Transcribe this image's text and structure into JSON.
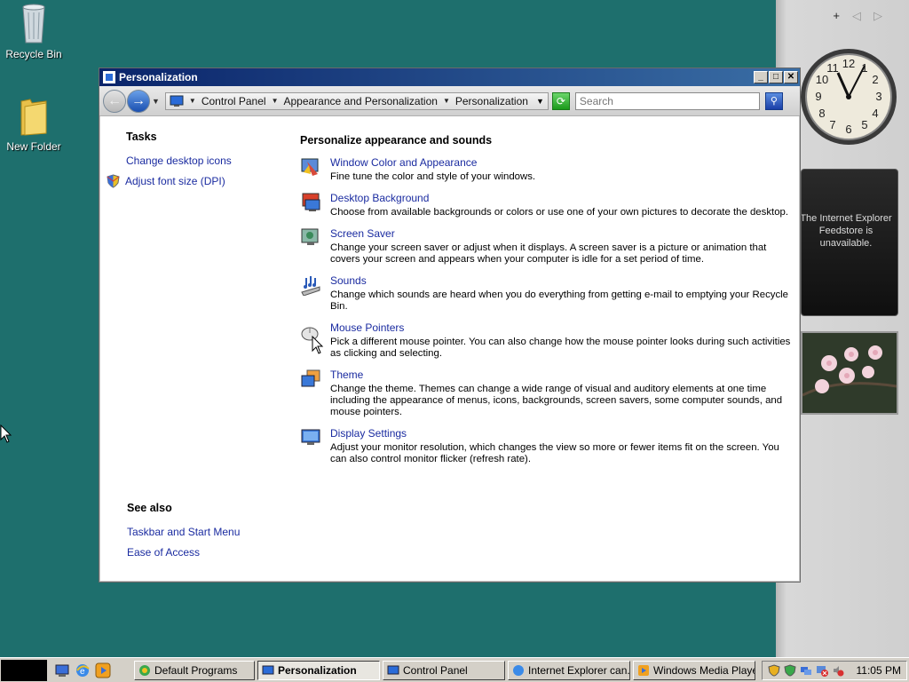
{
  "desktop": {
    "icons": [
      {
        "label": "Recycle Bin",
        "icon": "recycle-bin-icon"
      },
      {
        "label": "New Folder",
        "icon": "folder-icon"
      }
    ]
  },
  "sidebar": {
    "add_glyph": "+",
    "prev_glyph": "◁",
    "next_glyph": "▷",
    "clock_numbers": [
      "12",
      "1",
      "2",
      "3",
      "4",
      "5",
      "6",
      "7",
      "8",
      "9",
      "10",
      "11"
    ],
    "feed_message": "The Internet Explorer Feedstore is unavailable."
  },
  "window": {
    "title": "Personalization",
    "minimize": "_",
    "maximize": "□",
    "close": "✕",
    "address": {
      "crumbs": [
        "Control Panel",
        "Appearance and Personalization",
        "Personalization"
      ]
    },
    "search_placeholder": "Search",
    "tasks": {
      "heading": "Tasks",
      "links": [
        "Change desktop icons",
        "Adjust font size (DPI)"
      ]
    },
    "see_also": {
      "heading": "See also",
      "links": [
        "Taskbar and Start Menu",
        "Ease of Access"
      ]
    },
    "main": {
      "heading": "Personalize appearance and sounds",
      "items": [
        {
          "label": "Window Color and Appearance",
          "desc": "Fine tune the color and style of your windows.",
          "icon": "window-color-icon"
        },
        {
          "label": "Desktop Background",
          "desc": "Choose from available backgrounds or colors or use one of your own pictures to decorate the desktop.",
          "icon": "desktop-background-icon"
        },
        {
          "label": "Screen Saver",
          "desc": "Change your screen saver or adjust when it displays. A screen saver is a picture or animation that covers your screen and appears when your computer is idle for a set period of time.",
          "icon": "screen-saver-icon"
        },
        {
          "label": "Sounds",
          "desc": "Change which sounds are heard when you do everything from getting e-mail to emptying your Recycle Bin.",
          "icon": "sounds-icon"
        },
        {
          "label": "Mouse Pointers",
          "desc": "Pick a different mouse pointer. You can also change how the mouse pointer looks during such activities as clicking and selecting.",
          "icon": "mouse-icon"
        },
        {
          "label": "Theme",
          "desc": "Change the theme. Themes can change a wide range of visual and auditory elements at one time including the appearance of menus, icons, backgrounds, screen savers, some computer sounds, and mouse pointers.",
          "icon": "theme-icon"
        },
        {
          "label": "Display Settings",
          "desc": "Adjust your monitor resolution, which changes the view so more or fewer items fit on the screen. You can also control monitor flicker (refresh rate).",
          "icon": "display-settings-icon"
        }
      ]
    }
  },
  "taskbar": {
    "tasks": [
      {
        "label": "Default Programs",
        "active": false
      },
      {
        "label": "Personalization",
        "active": true
      },
      {
        "label": "Control Panel",
        "active": false
      },
      {
        "label": "Internet Explorer can...",
        "active": false
      },
      {
        "label": "Windows Media Player",
        "active": false
      }
    ],
    "time": "11:05 PM"
  }
}
